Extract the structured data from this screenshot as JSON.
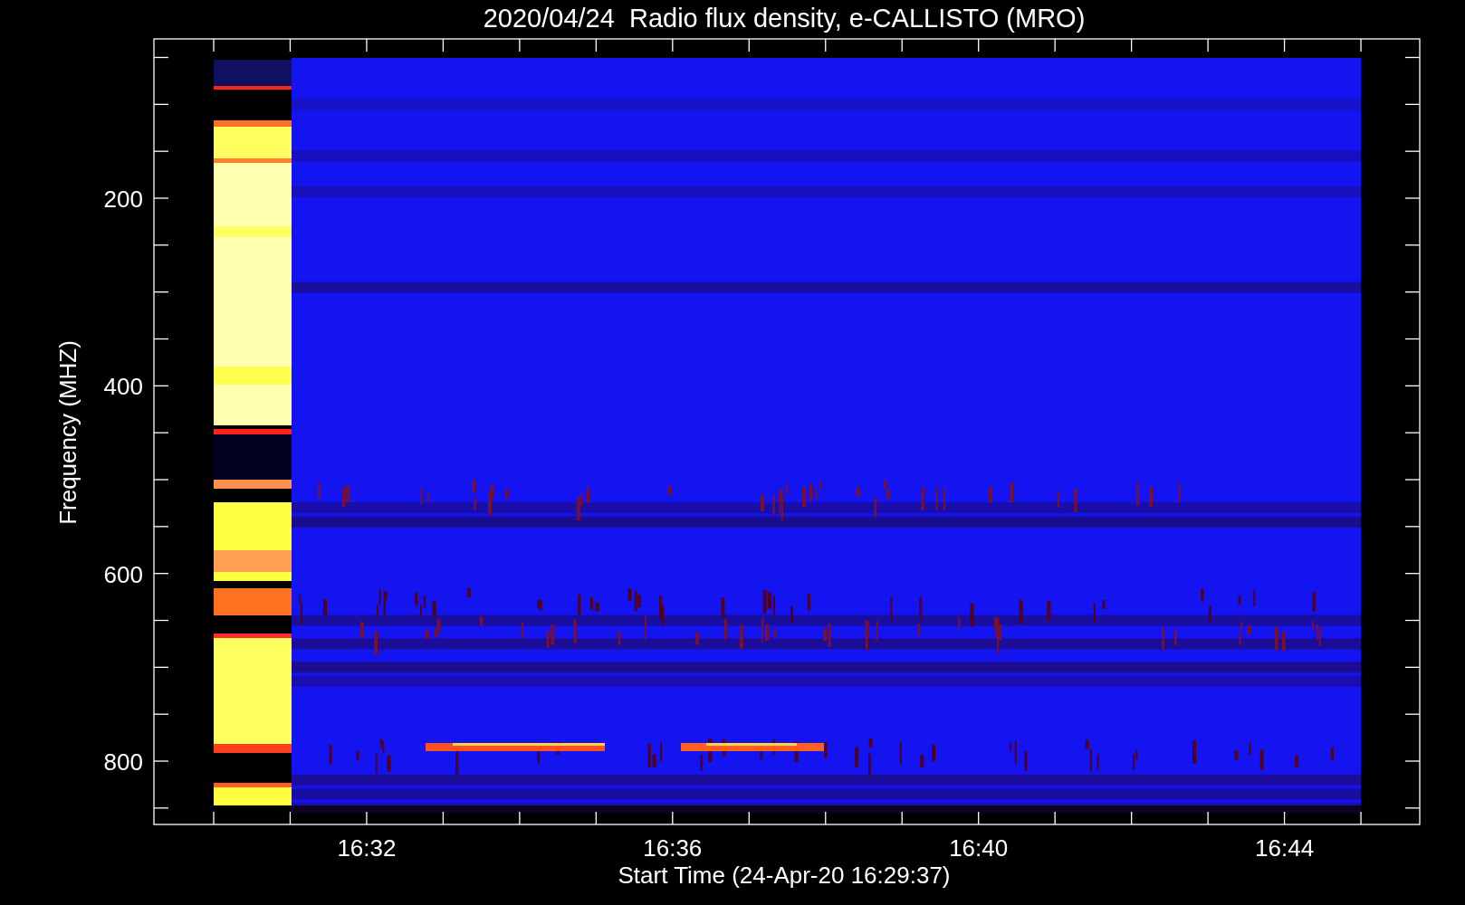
{
  "title": "2020/04/24  Radio flux density, e-CALLISTO (MRO)",
  "y_axis": {
    "label": "Frequency (MHZ)",
    "ticks": [
      "200",
      "400",
      "600",
      "800"
    ]
  },
  "x_axis": {
    "label": "Start Time (24-Apr-20 16:29:37)",
    "ticks": [
      "16:32",
      "16:36",
      "16:40",
      "16:44"
    ]
  }
}
